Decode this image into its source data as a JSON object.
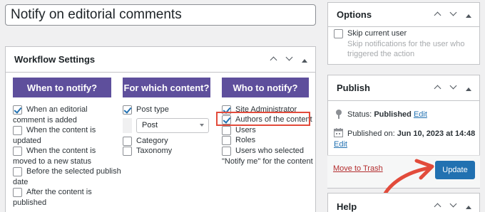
{
  "title_input": {
    "value": "Notify on editorial comments"
  },
  "workflow": {
    "title": "Workflow Settings",
    "columns": {
      "when": {
        "heading": "When to notify?",
        "items": [
          {
            "label_lines": [
              "When an editorial",
              "comment is added"
            ],
            "checked": true
          },
          {
            "label_lines": [
              "When the content is",
              "updated"
            ],
            "checked": false
          },
          {
            "label_lines": [
              "When the content is",
              "moved to a new status"
            ],
            "checked": false
          },
          {
            "label_lines": [
              "Before the selected publish",
              "date"
            ],
            "checked": false
          },
          {
            "label_lines": [
              "After the content is",
              "published"
            ],
            "checked": false
          }
        ]
      },
      "content": {
        "heading": "For which content?",
        "post_type_label": "Post type",
        "post_type_checked": true,
        "select_value": "Post",
        "category_label": "Category",
        "taxonomy_label": "Taxonomy"
      },
      "who": {
        "heading": "Who to notify?",
        "items": [
          {
            "label": "Site Administrator",
            "checked": true
          },
          {
            "label": "Authors of the content",
            "checked": true
          },
          {
            "label": "Users",
            "checked": false
          },
          {
            "label": "Roles",
            "checked": false
          },
          {
            "label": "Users who selected",
            "checked": false
          }
        ],
        "continuation": "\"Notify me\" for the content"
      }
    }
  },
  "options": {
    "title": "Options",
    "skip_label": "Skip current user",
    "skip_desc_lines": [
      "Skip notifications for the user who",
      "triggered the action"
    ]
  },
  "publish": {
    "title": "Publish",
    "status_label": "Status:",
    "status_value": "Published",
    "status_edit": "Edit",
    "published_on_label": "Published on:",
    "published_on_value": "Jun 10, 2023 at 14:48",
    "published_edit": "Edit",
    "trash_label": "Move to Trash",
    "update_label": "Update"
  },
  "help": {
    "title": "Help"
  },
  "colors": {
    "column_header": "#5e4f9c",
    "primary": "#2271b1",
    "highlight": "#e24b3b",
    "trash": "#b32d2e"
  }
}
